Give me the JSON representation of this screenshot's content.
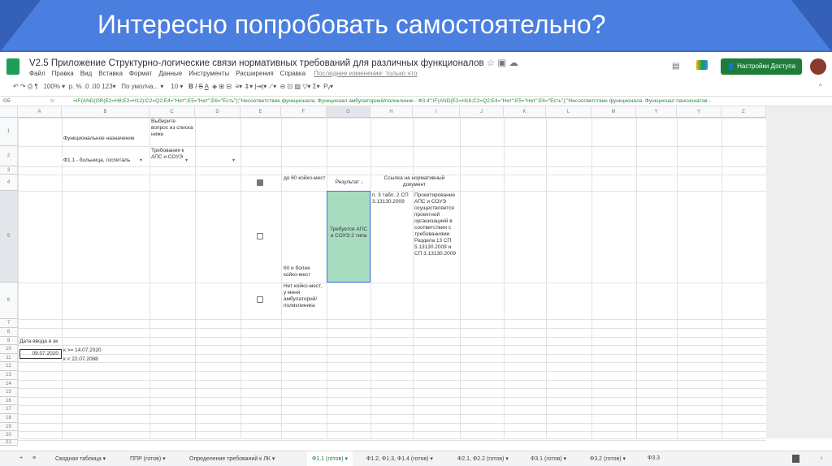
{
  "slide": {
    "title": "Интересно попробовать самостоятельно?"
  },
  "doc": {
    "title": "V2.5 Приложение Структурно-логические связи нормативных требований для различных функционалов",
    "menu": [
      "Файл",
      "Правка",
      "Вид",
      "Вставка",
      "Формат",
      "Данные",
      "Инструменты",
      "Расширения",
      "Справка"
    ],
    "last_edit": "Последнее изменение: только что",
    "share": "Настройки Доступа"
  },
  "toolbar": {
    "zoom": "100%",
    "currency": "р.",
    "percent": "%",
    "dec1": ".0",
    "dec2": ".00",
    "numfmt": "123",
    "font": "По умолча...",
    "size": "10"
  },
  "formula": {
    "cell": "G5",
    "text": "=IF(AND(OR(E2=H8;E2=H12);C2=Q2;E4=\"Нет\";E5=\"Нет\";E6=\"Есть\");\"Несоответствие функционала. Функционал амбулаторией/поликлиник - Ф3.4\";IF(AND(E2=H16;C2=Q2;E4=\"Нет\";E5=\"Нет\";E6=\"Есть\");\"Несоответствие функционала. Функционал пансионатов - "
  },
  "columns": [
    "A",
    "B",
    "C",
    "D",
    "E",
    "F",
    "G",
    "H",
    "I",
    "J",
    "K",
    "L",
    "M",
    "Y",
    "Y",
    "Z"
  ],
  "rows": [
    "1",
    "2",
    "3",
    "4",
    "5",
    "6",
    "7",
    "8",
    "9",
    "10",
    "11",
    "12",
    "13",
    "14",
    "15",
    "16",
    "17",
    "18",
    "19",
    "20",
    "21"
  ],
  "cells": {
    "b1": "Функциональное назначение",
    "c1": "Выберите вопрос из списка ниже",
    "b2": "Ф1.1 - больница, госпиталь",
    "c2": "Требования к АПС и СОУЭ",
    "f4": "до 60 койко-мест",
    "g4": "Результат ↓",
    "h4": "Ссылка на нормативный документ",
    "g5": "Требуется АПС и СОУЭ 2 типа",
    "h5": "п. 3 табл. 2 СП 3.13130.2009",
    "i5": "Проектирование АПС и СОУЭ осуществляется проектной организацией в соответствии с требованиями Раздела 13 СП 5.13130.2009 и СП 3.13130.2009",
    "f5": "60 и более койко-мест",
    "f6": "Нет койко-мест, у меня амбулаторий/поликлиника",
    "a9": "Дата ввода в эк",
    "a10": "09.07.2020",
    "b10": "к >= 14.07.2020",
    "b11": "к < 22.07.2088"
  },
  "sheets": [
    "Сводная таблица",
    "ППР (готов)",
    "Определение требований к ЛК",
    "Ф1.1 (готов)",
    "Ф1.2, Ф1.3, Ф1.4 (готов)",
    "Ф2.1, Ф2.2 (готов)",
    "Ф3.1 (готов)",
    "Ф3.2 (готов)",
    "Ф3.3"
  ],
  "colors": {
    "accent": "#4a7fe0",
    "share": "#1e7d3a",
    "selected": "#a8dcc0"
  }
}
